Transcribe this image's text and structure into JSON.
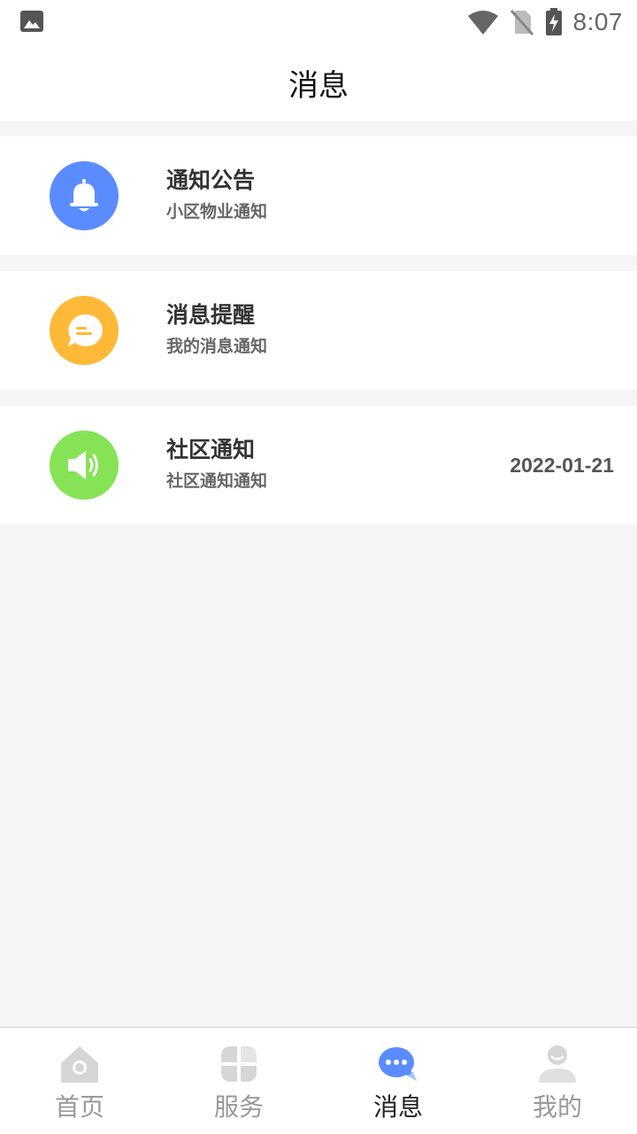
{
  "status_bar": {
    "time": "8:07",
    "icons": [
      "image-icon",
      "wifi-icon",
      "no-sim-icon",
      "battery-charging-icon"
    ]
  },
  "header": {
    "title": "消息"
  },
  "messages": [
    {
      "title": "通知公告",
      "subtitle": "小区物业通知",
      "date": "",
      "icon": "bell-icon",
      "color": "#5b8cff"
    },
    {
      "title": "消息提醒",
      "subtitle": "我的消息通知",
      "date": "",
      "icon": "chat-bubble-icon",
      "color": "#ffb938"
    },
    {
      "title": "社区通知",
      "subtitle": "社区通知通知",
      "date": "2022-01-21",
      "icon": "speaker-icon",
      "color": "#86e356"
    }
  ],
  "tabbar": {
    "items": [
      {
        "label": "首页",
        "icon": "home-icon",
        "active": false
      },
      {
        "label": "服务",
        "icon": "grid-icon",
        "active": false
      },
      {
        "label": "消息",
        "icon": "message-icon",
        "active": true
      },
      {
        "label": "我的",
        "icon": "user-icon",
        "active": false
      }
    ],
    "active_color": "#5b8cff",
    "inactive_color": "#d6d6d6"
  }
}
